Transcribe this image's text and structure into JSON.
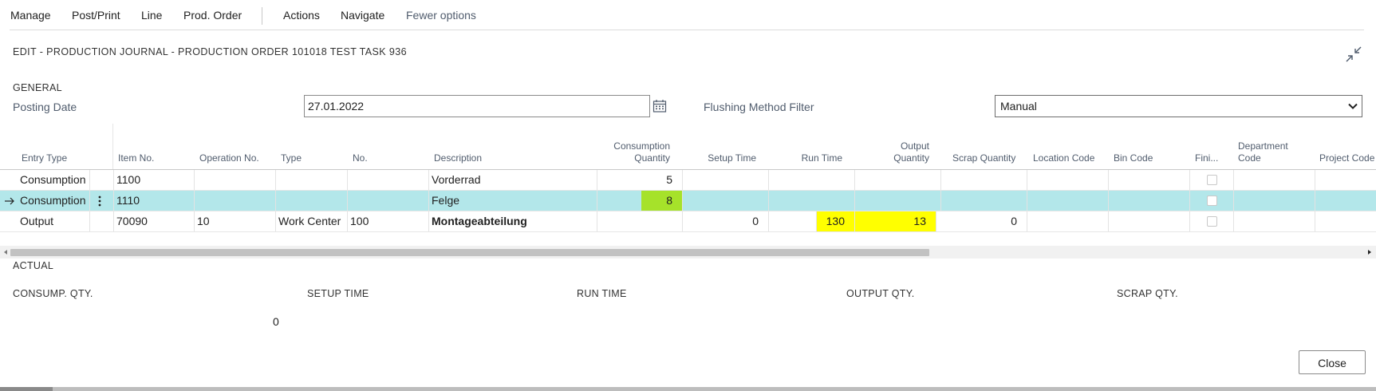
{
  "actionbar": {
    "items": [
      "Manage",
      "Post/Print",
      "Line",
      "Prod. Order",
      "Actions",
      "Navigate",
      "Fewer options"
    ]
  },
  "page": {
    "title": "EDIT - PRODUCTION JOURNAL - PRODUCTION ORDER 101018 TEST TASK 936"
  },
  "general": {
    "caption": "GENERAL",
    "posting_date_label": "Posting Date",
    "posting_date_value": "27.01.2022",
    "flushing_label": "Flushing Method Filter",
    "flushing_value": "Manual"
  },
  "grid": {
    "headers": {
      "entry_type": "Entry Type",
      "item_no": "Item No.",
      "operation_no": "Operation No.",
      "type": "Type",
      "no": "No.",
      "description": "Description",
      "consumption_qty_1": "Consumption",
      "consumption_qty_2": "Quantity",
      "setup_time": "Setup Time",
      "run_time": "Run Time",
      "output_qty_1": "Output",
      "output_qty_2": "Quantity",
      "scrap_qty": "Scrap Quantity",
      "location_code": "Location Code",
      "bin_code": "Bin Code",
      "finished": "Fini...",
      "department_code_1": "Department",
      "department_code_2": "Code",
      "project_code": "Project Code"
    },
    "rows": [
      {
        "entry_type": "Consumption",
        "item_no": "1100",
        "operation_no": "",
        "type": "",
        "no": "",
        "description": "Vorderrad",
        "consumption_qty": "5",
        "setup_time": "",
        "run_time": "",
        "output_qty": "",
        "scrap_qty": "",
        "finished": false
      },
      {
        "entry_type": "Consumption",
        "item_no": "1110",
        "operation_no": "",
        "type": "",
        "no": "",
        "description": "Felge",
        "consumption_qty": "8",
        "setup_time": "",
        "run_time": "",
        "output_qty": "",
        "scrap_qty": "",
        "finished": false
      },
      {
        "entry_type": "Output",
        "item_no": "70090",
        "operation_no": "10",
        "type": "Work Center",
        "no": "100",
        "description": "Montageabteilung",
        "consumption_qty": "",
        "setup_time": "0",
        "run_time": "130",
        "output_qty": "13",
        "scrap_qty": "0",
        "finished": false
      }
    ]
  },
  "actual": {
    "caption": "ACTUAL",
    "consump_qty_label": "CONSUMP. QTY.",
    "consump_qty_value": "0",
    "setup_time_label": "SETUP TIME",
    "run_time_label": "RUN TIME",
    "output_qty_label": "OUTPUT QTY.",
    "scrap_qty_label": "SCRAP QTY."
  },
  "footer": {
    "close_label": "Close"
  },
  "colors": {
    "selected_row": "#b3e7ea",
    "highlight_green": "#a6e22a",
    "highlight_yellow": "#ffff00"
  },
  "icons": [
    "calendar-icon",
    "chevron-down-icon",
    "collapse-icon",
    "row-arrow-icon",
    "row-menu-icon",
    "scroll-left-icon",
    "scroll-right-icon"
  ]
}
